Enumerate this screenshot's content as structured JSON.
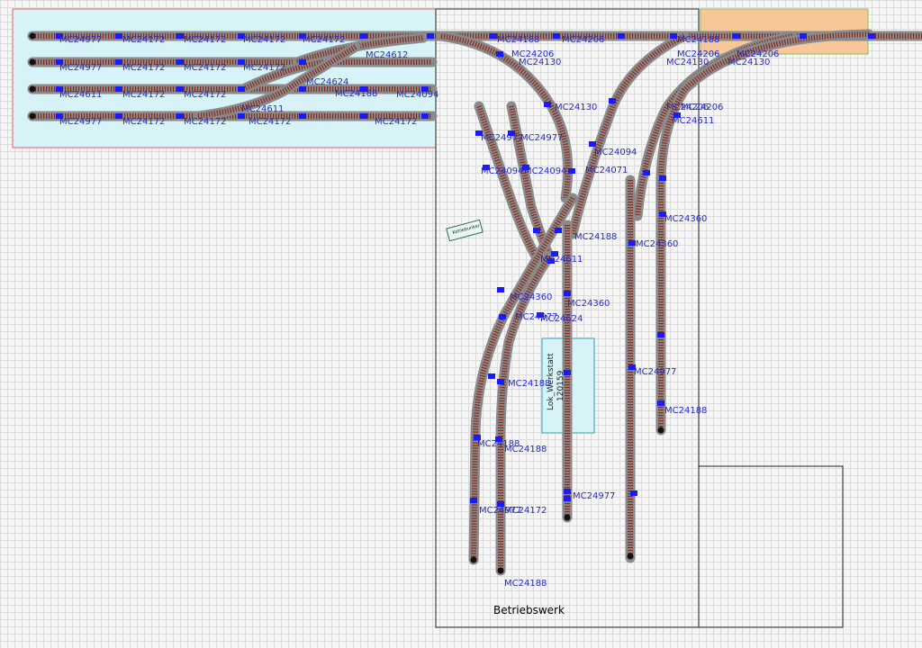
{
  "areas": {
    "betriebswerk_label": "Betriebswerk"
  },
  "workshop": {
    "name": "Lok_Werkstatt",
    "number": "120159"
  },
  "colors": {
    "track_bed": "#8a8a8a",
    "track_rail": "#8c2a1e",
    "joint": "#1a1aff",
    "label": "#2a2acc",
    "staging_area": "#d8f3f7",
    "orange_area": "#f7c79a"
  },
  "track_labels": [
    "MC24977",
    "MC24172",
    "MC24172",
    "MC24172",
    "MC24172",
    "MC24188",
    "MC24206",
    "MC24188",
    "MC24977",
    "MC24172",
    "MC24172",
    "MC24172",
    "MC24612",
    "MC24611",
    "MC24172",
    "MC24172",
    "MC24624",
    "MC24188",
    "MC24094",
    "MC24977",
    "MC24172",
    "MC24172",
    "MC24172",
    "MC24611",
    "MC24172",
    "MC24206",
    "MC24130",
    "MC24130",
    "MC24206",
    "MC24130",
    "MC24206",
    "MC24130",
    "MC24206",
    "MC24206",
    "MC24611",
    "MC24977",
    "MC24094",
    "MC24094",
    "MC24071",
    "MC24094",
    "MC24360",
    "MC24977",
    "MC24188",
    "MC24611",
    "MC24360",
    "MC24977",
    "MC24624",
    "MC24188",
    "MC24360",
    "MC24188",
    "MC24188",
    "MC24977",
    "MC24360",
    "MC24977",
    "MC24188",
    "MC24977",
    "MC24172",
    "MC24188"
  ],
  "notes": [
    "Kohlebunker"
  ]
}
